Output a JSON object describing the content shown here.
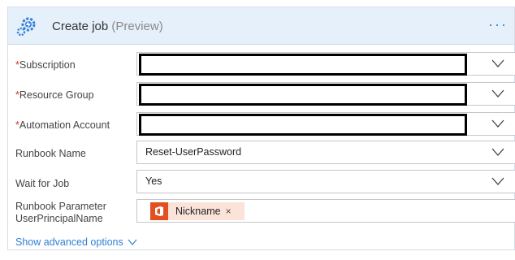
{
  "header": {
    "title": "Create job",
    "preview": "(Preview)",
    "more": "···",
    "icon": "automation-gear-icon"
  },
  "fields": {
    "subscription": {
      "required": "*",
      "label": "Subscription",
      "value": ""
    },
    "resource_group": {
      "required": "*",
      "label": "Resource Group",
      "value": ""
    },
    "automation_account": {
      "required": "*",
      "label": "Automation Account",
      "value": ""
    },
    "runbook_name": {
      "label": "Runbook Name",
      "value": "Reset-UserPassword"
    },
    "wait_for_job": {
      "label": "Wait for Job",
      "value": "Yes"
    },
    "runbook_parameter": {
      "label_line1": "Runbook Parameter",
      "label_line2": "UserPrincipalName",
      "token": {
        "label": "Nickname",
        "remove": "×",
        "icon": "office-icon"
      }
    }
  },
  "advanced": {
    "label": "Show advanced options"
  },
  "colors": {
    "header_bg": "#e6f0fa",
    "accent": "#2f7fd6",
    "required": "#d9312b",
    "token_bg": "#fbe3d9",
    "office": "#e24f21"
  }
}
